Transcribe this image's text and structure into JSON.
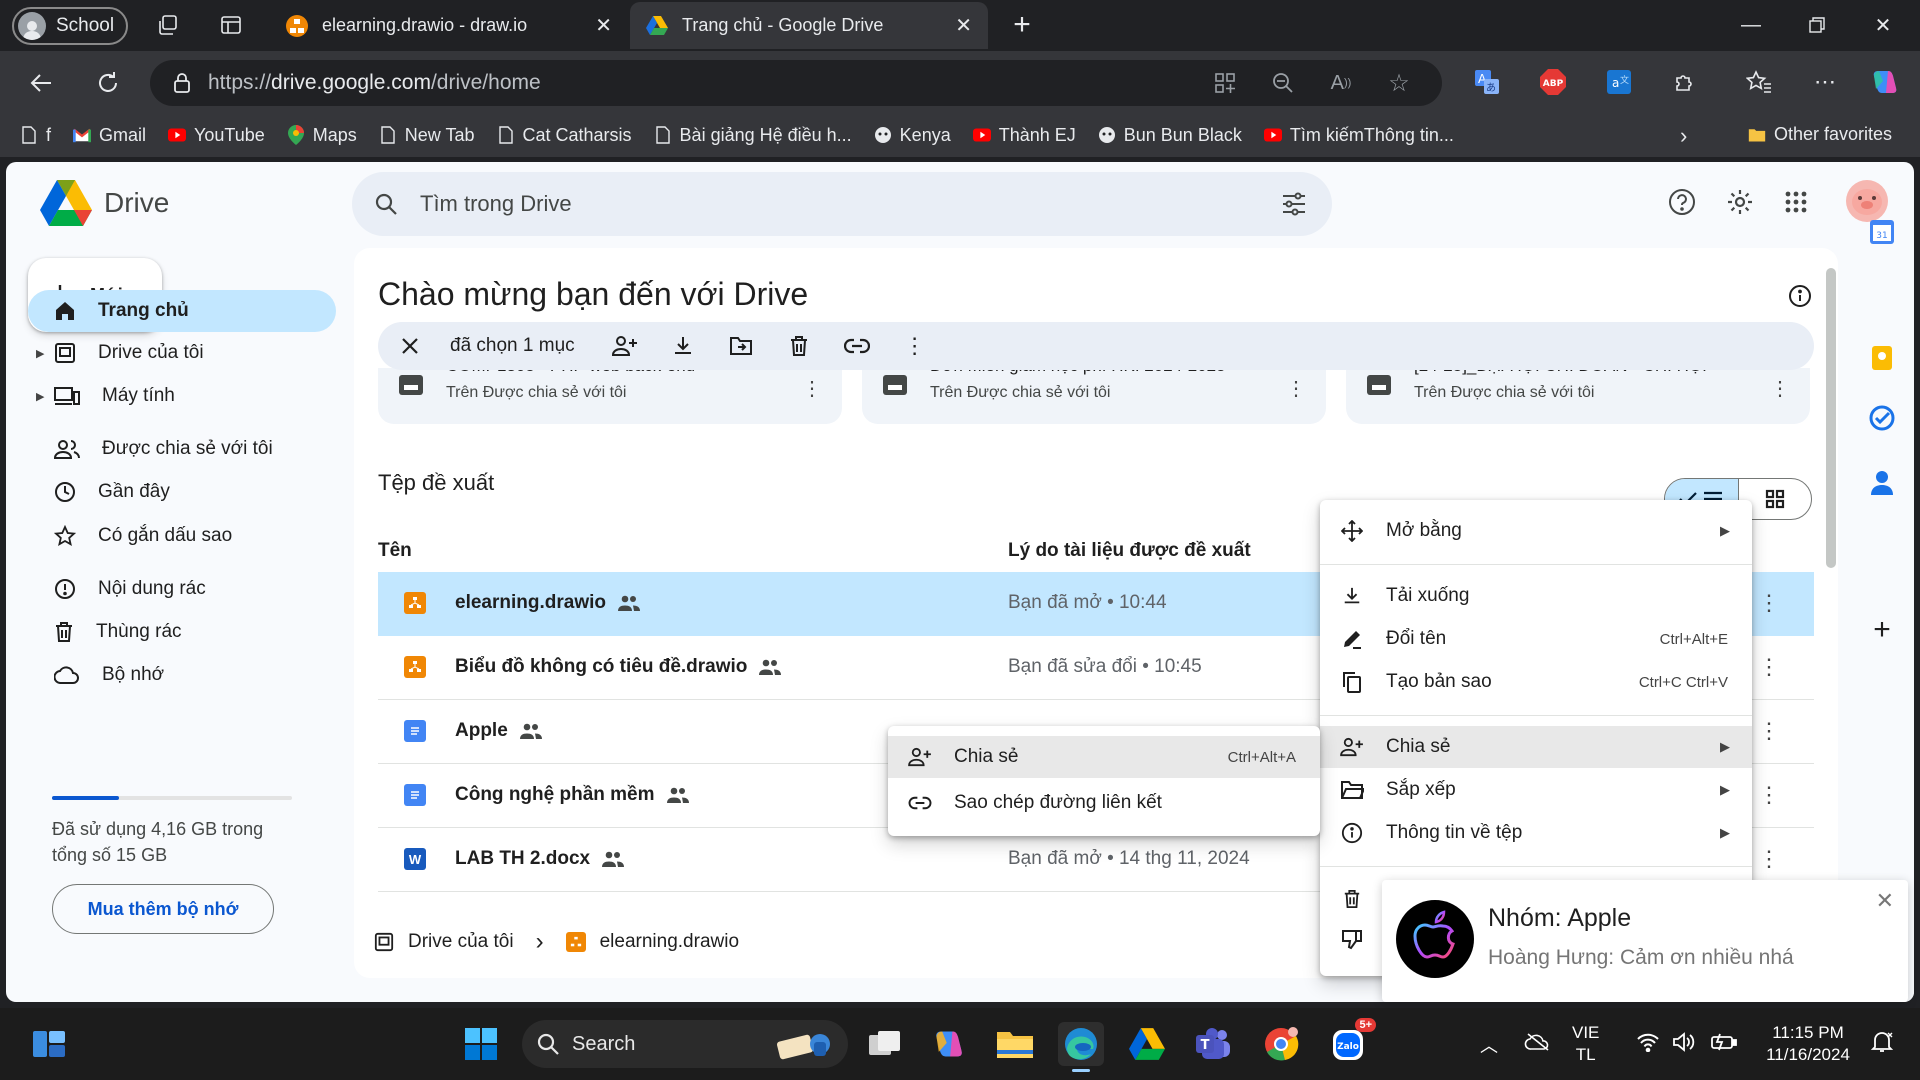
{
  "browser": {
    "profile_label": "School",
    "tabs": [
      {
        "title": "elearning.drawio - draw.io"
      },
      {
        "title": "Trang chủ - Google Drive"
      }
    ],
    "url_prefix": "https://",
    "url_host": "drive.google.com",
    "url_path": "/drive/home",
    "bookmarks": [
      "f",
      "Gmail",
      "YouTube",
      "Maps",
      "New Tab",
      "Cat Catharsis",
      "Bài giảng Hệ điều h...",
      "Kenya",
      "Thành EJ",
      "Bun Bun Black",
      "Tìm kiếmThông tin..."
    ],
    "other_favorites": "Other favorites",
    "abp_label": "ABP"
  },
  "drive": {
    "app_name": "Drive",
    "search_placeholder": "Tìm trong Drive",
    "new_button": "Mới",
    "sidebar": [
      {
        "label": "Trang chủ"
      },
      {
        "label": "Drive của tôi"
      },
      {
        "label": "Máy tính"
      },
      {
        "label": "Được chia sẻ với tôi"
      },
      {
        "label": "Gần đây"
      },
      {
        "label": "Có gắn dấu sao"
      },
      {
        "label": "Nội dung rác"
      },
      {
        "label": "Thùng rác"
      },
      {
        "label": "Bộ nhớ"
      }
    ],
    "storage_used_fraction": 0.28,
    "storage_text": "Đã sử dụng 4,16 GB trong tổng số 15 GB",
    "buy_storage": "Mua thêm bộ nhớ",
    "welcome_title": "Chào mừng bạn đến với Drive",
    "selection_text": "đã chọn 1 mục",
    "cards": [
      {
        "title": "COMP1305 - PHP web back-end",
        "sub": "Trên Được chia sẻ với tôi"
      },
      {
        "title": "Đơn Miễn giảm học phí HKI 2024-2025",
        "sub": "Trên Được chia sẻ với tôi"
      },
      {
        "title": "[24-25]_ĐẠI HỘI CHI ĐOÀN - CHI HỘI",
        "sub": "Trên Được chia sẻ với tôi"
      }
    ],
    "section_title": "Tệp đề xuất",
    "col_name": "Tên",
    "col_reason": "Lý do tài liệu được đề xuất",
    "files": [
      {
        "name": "elearning.drawio",
        "reason": "Bạn đã mở • 10:44",
        "type": "drawio"
      },
      {
        "name": "Biểu đồ không có tiêu đề.drawio",
        "reason": "Bạn đã sửa đổi • 10:45",
        "type": "drawio"
      },
      {
        "name": "Apple",
        "reason": "",
        "type": "doc"
      },
      {
        "name": "Công nghệ phần mềm",
        "reason": "",
        "type": "doc"
      },
      {
        "name": "LAB TH 2.docx",
        "reason": "Bạn đã mở • 14 thg 11, 2024",
        "type": "word"
      }
    ],
    "breadcrumb_root": "Drive của tôi",
    "breadcrumb_file": "elearning.drawio"
  },
  "context_menu": {
    "items": [
      {
        "label": "Mở bằng",
        "shortcut": "",
        "submenu": true
      },
      {
        "label": "Tải xuống",
        "shortcut": "",
        "submenu": false
      },
      {
        "label": "Đổi tên",
        "shortcut": "Ctrl+Alt+E",
        "submenu": false
      },
      {
        "label": "Tạo bản sao",
        "shortcut": "Ctrl+C Ctrl+V",
        "submenu": false
      },
      {
        "label": "Chia sẻ",
        "shortcut": "",
        "submenu": true
      },
      {
        "label": "Sắp xếp",
        "shortcut": "",
        "submenu": true
      },
      {
        "label": "Thông tin về tệp",
        "shortcut": "",
        "submenu": true
      }
    ]
  },
  "share_submenu": {
    "items": [
      {
        "label": "Chia sẻ",
        "shortcut": "Ctrl+Alt+A"
      },
      {
        "label": "Sao chép đường liên kết",
        "shortcut": ""
      }
    ]
  },
  "notification": {
    "title": "Nhóm: Apple",
    "message": "Hoàng Hưng: Cảm ơn nhiều nhá"
  },
  "taskbar": {
    "search_label": "Search",
    "lang_top": "VIE",
    "lang_bottom": "TL",
    "time": "11:15 PM",
    "date": "11/16/2024",
    "zalo_badge": "5+"
  },
  "colors": {
    "accent": "#0b57d0",
    "selected": "#c2e7ff",
    "drawio": "#f08705",
    "doc": "#4285f4",
    "word": "#185abd"
  }
}
